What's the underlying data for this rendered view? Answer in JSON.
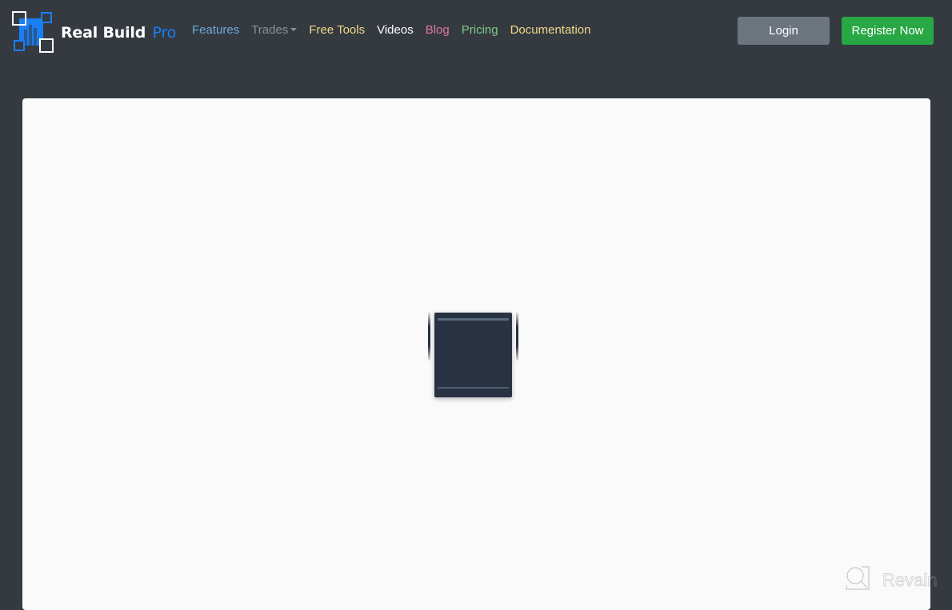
{
  "navbar": {
    "brand": {
      "name": "Real Build",
      "suffix": "Pro",
      "logo_icon": "building-chart-logo-icon",
      "accent_color": "#1a7ef5"
    },
    "links": [
      {
        "label": "Features",
        "color": "#6fa8dc"
      },
      {
        "label": "Trades",
        "color": "#8a9099",
        "has_dropdown": true
      },
      {
        "label": "Free Tools",
        "color": "#f1d88a"
      },
      {
        "label": "Videos",
        "color": "#ffffff"
      },
      {
        "label": "Blog",
        "color": "#e07a9b"
      },
      {
        "label": "Pricing",
        "color": "#82c98a"
      },
      {
        "label": "Documentation",
        "color": "#f1d88a"
      }
    ],
    "login_label": "Login",
    "register_label": "Register Now",
    "login_color": "#6c757d",
    "register_color": "#28a745"
  },
  "main": {
    "loader_icon": "loading-spinner-icon"
  },
  "watermark": {
    "text": "Revain",
    "icon": "revain-logo-icon"
  }
}
